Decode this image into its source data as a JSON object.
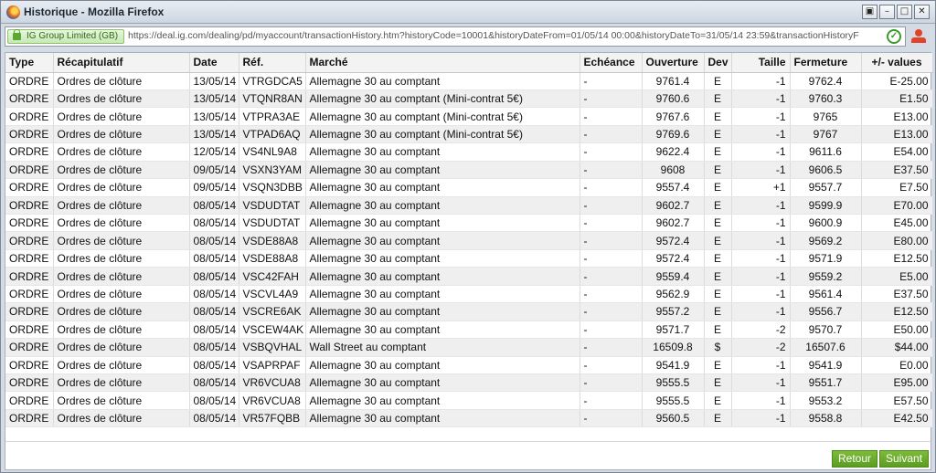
{
  "window": {
    "title": "Historique - Mozilla Firefox",
    "buttons": [
      "▣",
      "–",
      "□",
      "✕"
    ]
  },
  "urlbar": {
    "identity": "IG Group Limited (GB)",
    "url": "https://deal.ig.com/dealing/pd/myaccount/transactionHistory.htm?historyCode=10001&historyDateFrom=01/05/14 00:00&historyDateTo=31/05/14 23:59&transactionHistoryF",
    "go_icon": "✓"
  },
  "table": {
    "headers": [
      "Type",
      "Récapitulatif",
      "Date",
      "Réf.",
      "Marché",
      "Echéance",
      "Ouverture",
      "Dev",
      "Taille",
      "Fermeture",
      "+/- values"
    ],
    "rows": [
      [
        "ORDRE",
        "Ordres de clôture",
        "13/05/14",
        "VTRGDCA5",
        "Allemagne 30 au comptant",
        "-",
        "9761.4",
        "E",
        "-1",
        "9762.4",
        "E-25.00"
      ],
      [
        "ORDRE",
        "Ordres de clôture",
        "13/05/14",
        "VTQNR8AN",
        "Allemagne 30 au comptant (Mini-contrat 5€)",
        "-",
        "9760.6",
        "E",
        "-1",
        "9760.3",
        "E1.50"
      ],
      [
        "ORDRE",
        "Ordres de clôture",
        "13/05/14",
        "VTPRA3AE",
        "Allemagne 30 au comptant (Mini-contrat 5€)",
        "-",
        "9767.6",
        "E",
        "-1",
        "9765",
        "E13.00"
      ],
      [
        "ORDRE",
        "Ordres de clôture",
        "13/05/14",
        "VTPAD6AQ",
        "Allemagne 30 au comptant (Mini-contrat 5€)",
        "-",
        "9769.6",
        "E",
        "-1",
        "9767",
        "E13.00"
      ],
      [
        "ORDRE",
        "Ordres de clôture",
        "12/05/14",
        "VS4NL9A8",
        "Allemagne 30 au comptant",
        "-",
        "9622.4",
        "E",
        "-1",
        "9611.6",
        "E54.00"
      ],
      [
        "ORDRE",
        "Ordres de clôture",
        "09/05/14",
        "VSXN3YAM",
        "Allemagne 30 au comptant",
        "-",
        "9608",
        "E",
        "-1",
        "9606.5",
        "E37.50"
      ],
      [
        "ORDRE",
        "Ordres de clôture",
        "09/05/14",
        "VSQN3DBB",
        "Allemagne 30 au comptant",
        "-",
        "9557.4",
        "E",
        "+1",
        "9557.7",
        "E7.50"
      ],
      [
        "ORDRE",
        "Ordres de clôture",
        "08/05/14",
        "VSDUDTAT",
        "Allemagne 30 au comptant",
        "-",
        "9602.7",
        "E",
        "-1",
        "9599.9",
        "E70.00"
      ],
      [
        "ORDRE",
        "Ordres de clôture",
        "08/05/14",
        "VSDUDTAT",
        "Allemagne 30 au comptant",
        "-",
        "9602.7",
        "E",
        "-1",
        "9600.9",
        "E45.00"
      ],
      [
        "ORDRE",
        "Ordres de clôture",
        "08/05/14",
        "VSDE88A8",
        "Allemagne 30 au comptant",
        "-",
        "9572.4",
        "E",
        "-1",
        "9569.2",
        "E80.00"
      ],
      [
        "ORDRE",
        "Ordres de clôture",
        "08/05/14",
        "VSDE88A8",
        "Allemagne 30 au comptant",
        "-",
        "9572.4",
        "E",
        "-1",
        "9571.9",
        "E12.50"
      ],
      [
        "ORDRE",
        "Ordres de clôture",
        "08/05/14",
        "VSC42FAH",
        "Allemagne 30 au comptant",
        "-",
        "9559.4",
        "E",
        "-1",
        "9559.2",
        "E5.00"
      ],
      [
        "ORDRE",
        "Ordres de clôture",
        "08/05/14",
        "VSCVL4A9",
        "Allemagne 30 au comptant",
        "-",
        "9562.9",
        "E",
        "-1",
        "9561.4",
        "E37.50"
      ],
      [
        "ORDRE",
        "Ordres de clôture",
        "08/05/14",
        "VSCRE6AK",
        "Allemagne 30 au comptant",
        "-",
        "9557.2",
        "E",
        "-1",
        "9556.7",
        "E12.50"
      ],
      [
        "ORDRE",
        "Ordres de clôture",
        "08/05/14",
        "VSCEW4AK",
        "Allemagne 30 au comptant",
        "-",
        "9571.7",
        "E",
        "-2",
        "9570.7",
        "E50.00"
      ],
      [
        "ORDRE",
        "Ordres de clôture",
        "08/05/14",
        "VSBQVHAL",
        "Wall Street au comptant",
        "-",
        "16509.8",
        "$",
        "-2",
        "16507.6",
        "$44.00"
      ],
      [
        "ORDRE",
        "Ordres de clôture",
        "08/05/14",
        "VSAPRPAF",
        "Allemagne 30 au comptant",
        "-",
        "9541.9",
        "E",
        "-1",
        "9541.9",
        "E0.00"
      ],
      [
        "ORDRE",
        "Ordres de clôture",
        "08/05/14",
        "VR6VCUA8",
        "Allemagne 30 au comptant",
        "-",
        "9555.5",
        "E",
        "-1",
        "9551.7",
        "E95.00"
      ],
      [
        "ORDRE",
        "Ordres de clôture",
        "08/05/14",
        "VR6VCUA8",
        "Allemagne 30 au comptant",
        "-",
        "9555.5",
        "E",
        "-1",
        "9553.2",
        "E57.50"
      ],
      [
        "ORDRE",
        "Ordres de clôture",
        "08/05/14",
        "VR57FQBB",
        "Allemagne 30 au comptant",
        "-",
        "9560.5",
        "E",
        "-1",
        "9558.8",
        "E42.50"
      ]
    ]
  },
  "footer": {
    "retour": "Retour",
    "suivant": "Suivant"
  },
  "colors": {
    "button_green": "#6aab2c",
    "row_alt": "#efefef"
  }
}
